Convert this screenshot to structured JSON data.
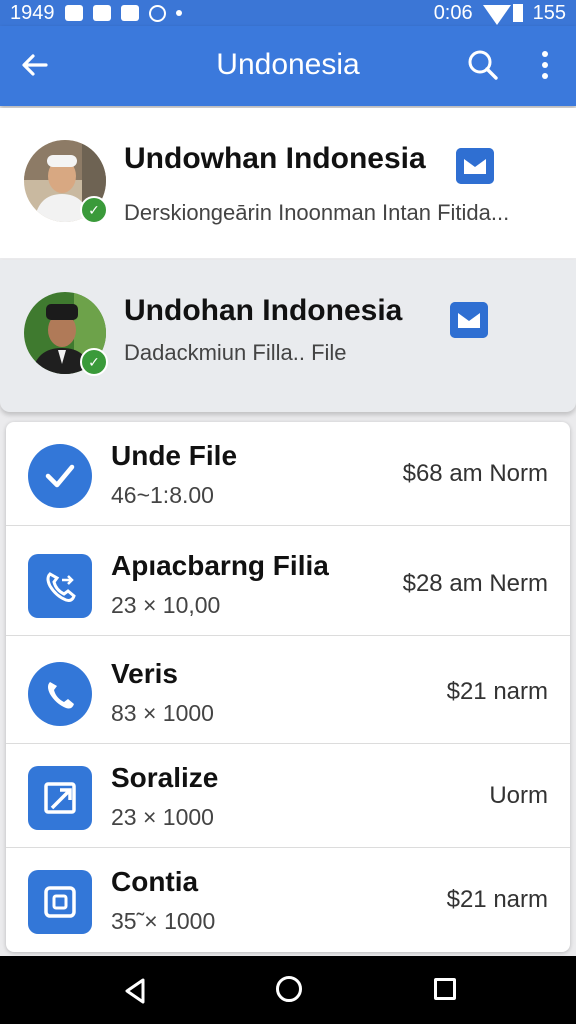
{
  "status": {
    "time_left": "1949",
    "time_right": "0:06",
    "battery": "155"
  },
  "appbar": {
    "title": "Undonesia"
  },
  "channels": [
    {
      "title": "Undowhan Indonesia",
      "subtitle": "Derskiongeārin Inoonman Intan Fitida..."
    },
    {
      "title": "Undohan Indonesia",
      "subtitle": "Dadackmiun Filla.. File"
    }
  ],
  "items": [
    {
      "name": "Unde File",
      "sub": "46~1:8.00",
      "price": "$68  am Norm",
      "icon": "check-icon"
    },
    {
      "name": "Apıacbarng Filia",
      "sub": "23 × 10,00",
      "price": "$28  am Nerm",
      "icon": "phone-call-icon"
    },
    {
      "name": "Veris",
      "sub": "83 × 1000",
      "price": "$21 narm",
      "icon": "phone-icon"
    },
    {
      "name": "Soralize",
      "sub": "23 × 1000",
      "price": "Uorm",
      "icon": "resize-icon"
    },
    {
      "name": "Contia",
      "sub": "35˜× 1000",
      "price": "$21 narm",
      "icon": "camera-icon"
    }
  ],
  "colors": {
    "primary": "#3b79dc",
    "icon_blue": "#3377d8",
    "badge_green": "#3a9a3a"
  }
}
